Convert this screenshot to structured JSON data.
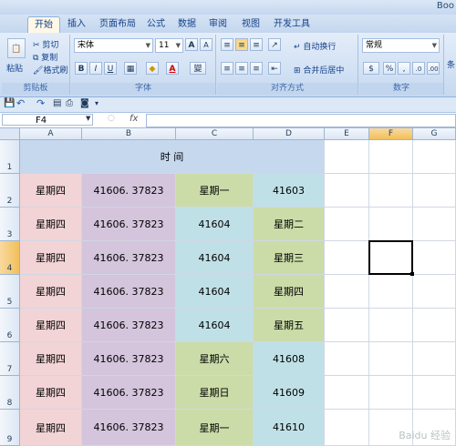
{
  "window": {
    "title": "Boo"
  },
  "tabs": [
    "开始",
    "插入",
    "页面布局",
    "公式",
    "数据",
    "审阅",
    "视图",
    "开发工具"
  ],
  "ribbon": {
    "clipboard": {
      "paste": "粘贴",
      "cut": "剪切",
      "copy": "复制",
      "format_painter": "格式刷",
      "label": "剪贴板"
    },
    "font": {
      "name": "宋体",
      "size": "11",
      "grow": "A",
      "shrink": "A",
      "bold": "B",
      "italic": "I",
      "underline": "U",
      "color_letter": "A",
      "phonetic": "變",
      "label": "字体"
    },
    "alignment": {
      "wrap": "自动换行",
      "merge": "合并后居中",
      "label": "对齐方式"
    },
    "number": {
      "format": "常规",
      "percent": "%",
      "comma": ",",
      "label": "数字"
    },
    "extra": {
      "label": "条"
    }
  },
  "formula_bar": {
    "name_box": "F4",
    "fx": "fx",
    "value": ""
  },
  "sheet": {
    "columns": [
      "A",
      "B",
      "C",
      "D",
      "E",
      "F",
      "G"
    ],
    "selected_column": "F",
    "rows": [
      "1",
      "2",
      "3",
      "4",
      "5",
      "6",
      "7",
      "8",
      "9"
    ],
    "selected_row": "4",
    "header_text": "时    间",
    "data": [
      [
        "星期四",
        "41606. 37823",
        "星期一",
        "41603"
      ],
      [
        "星期四",
        "41606. 37823",
        "41604",
        "星期二"
      ],
      [
        "星期四",
        "41606. 37823",
        "41604",
        "星期三"
      ],
      [
        "星期四",
        "41606. 37823",
        "41604",
        "星期四"
      ],
      [
        "星期四",
        "41606. 37823",
        "41604",
        "星期五"
      ],
      [
        "星期四",
        "41606. 37823",
        "星期六",
        "41608"
      ],
      [
        "星期四",
        "41606. 37823",
        "星期日",
        "41609"
      ],
      [
        "星期四",
        "41606. 37823",
        "星期一",
        "41610"
      ]
    ],
    "colors": {
      "a": "#f2d4d6",
      "b": "#d4c4dc",
      "green": "#cbdca8",
      "blue": "#bfe0e6",
      "header": "#c6d8ee"
    }
  },
  "watermark": "Baidu 经验"
}
